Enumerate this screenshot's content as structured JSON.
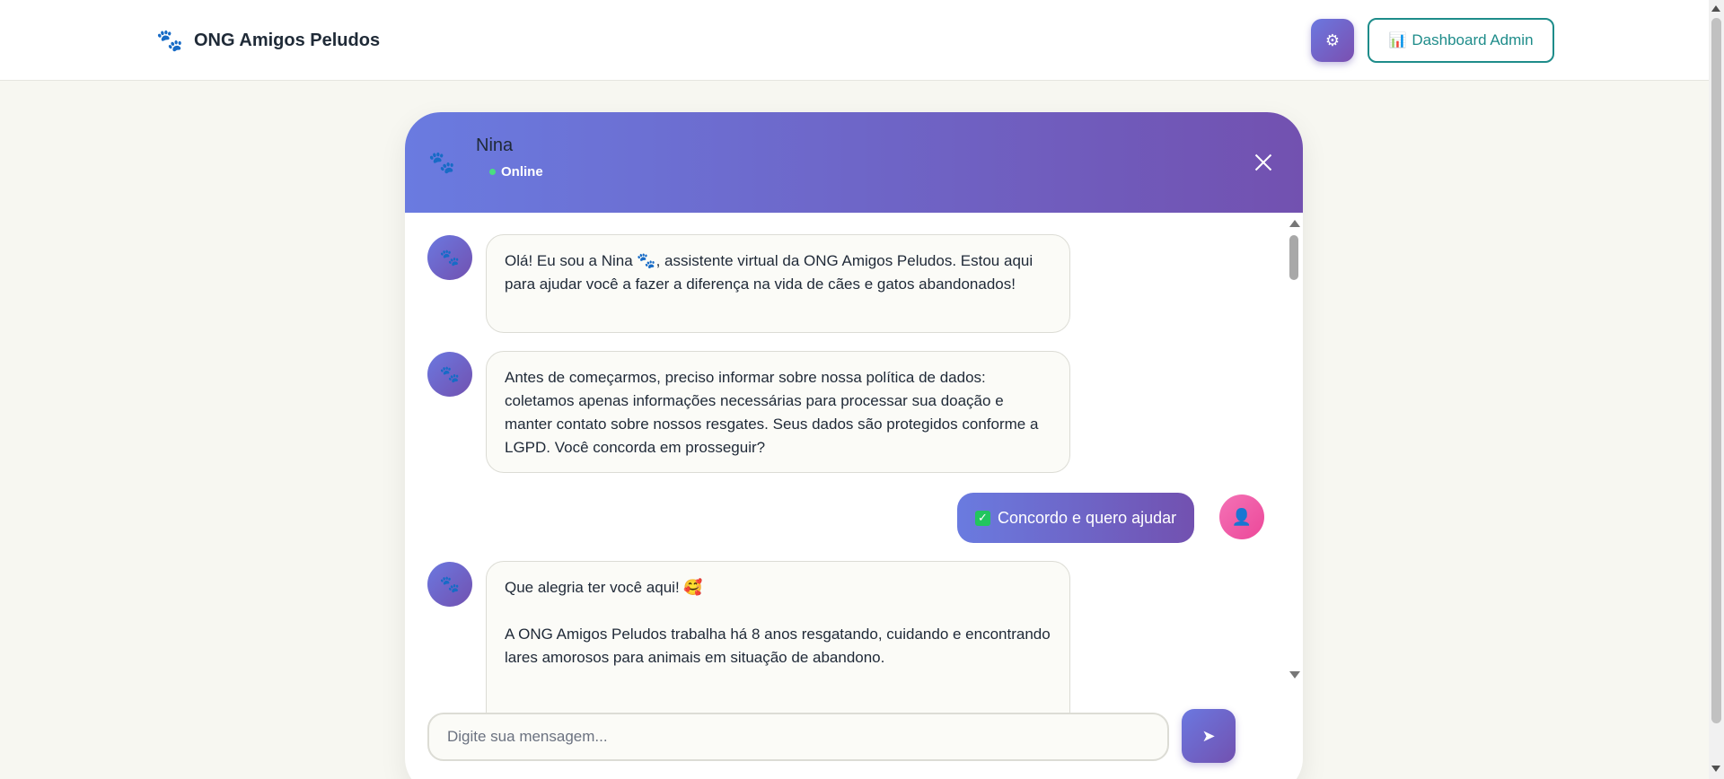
{
  "navbar": {
    "brand_icon": "paw-icon",
    "brand_name": "ONG Amigos Peludos",
    "settings_icon": "gear-icon",
    "admin_button_icon": "📊",
    "admin_button_label": "Dashboard Admin"
  },
  "chat": {
    "header": {
      "icon": "paw-icon",
      "bot_name": "Nina",
      "status": "Online"
    },
    "messages": [
      {
        "sender": "bot",
        "text": "Olá! Eu sou a Nina 🐾, assistente virtual da ONG Amigos Peludos. Estou aqui para ajudar você a fazer a diferença na vida de cães e gatos abandonados!"
      },
      {
        "sender": "bot",
        "text": "Antes de começarmos, preciso informar sobre nossa política de dados: coletamos apenas informações necessárias para processar sua doação e manter contato sobre nossos resgates. Seus dados são protegidos conforme a LGPD. Você concorda em prosseguir?"
      },
      {
        "sender": "user",
        "check": "✓",
        "text": "Concordo e quero ajudar"
      },
      {
        "sender": "bot",
        "line1": "Que alegria ter você aqui! 🥰",
        "line2": "A ONG Amigos Peludos trabalha há 8 anos resgatando, cuidando e encontrando lares amorosos para animais em situação de abandono."
      }
    ],
    "input": {
      "placeholder": "Digite sua mensagem...",
      "value": ""
    },
    "send_icon": "➤"
  },
  "colors": {
    "accent_start": "#6a7be0",
    "accent_end": "#7251b0",
    "admin_border": "#1e8c8a",
    "status_dot": "#4ade80",
    "user_avatar": "#ec4899"
  }
}
